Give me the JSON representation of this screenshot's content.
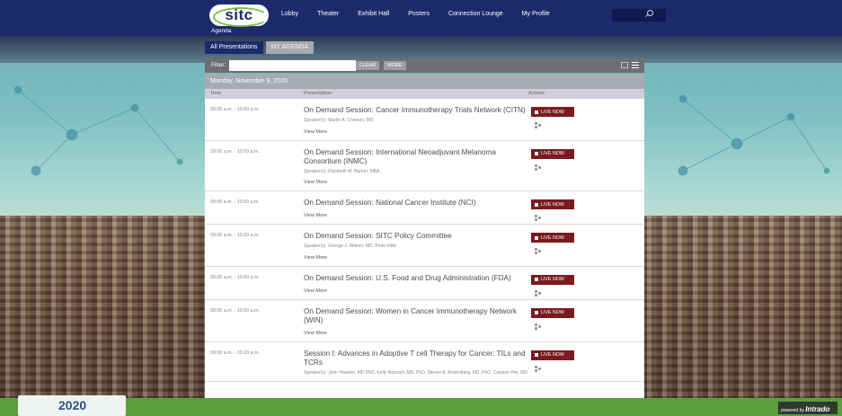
{
  "brand": {
    "logo_text": "sitc",
    "footer_logo_text": "2020",
    "powered_prefix": "powered by",
    "powered_brand": "Intrado"
  },
  "nav": {
    "items": [
      "Lobby",
      "Theater",
      "Exhibit Hall",
      "Posters",
      "Connection Lounge",
      "My Profile"
    ],
    "sub_item": "Agenda"
  },
  "search": {
    "placeholder": ""
  },
  "tabs": [
    "All Presentations",
    "MY AGENDA"
  ],
  "filter": {
    "label": "Filter:",
    "value": "",
    "clear_label": "CLEAR",
    "more_label": "MORE"
  },
  "date_header": "Monday, November 9, 2020",
  "columns": {
    "time": "Time",
    "presentation": "Presentation",
    "actions": "Actions"
  },
  "live_label": "LIVE NOW",
  "view_more_label": "View More",
  "sessions": [
    {
      "time": "09:00 a.m. - 10:00 a.m.",
      "title": "On Demand Session: Cancer Immunotherapy Trials Network (CITN)",
      "speakers": "Speaker(s): Martin A. Cheever, MD",
      "show_more": true
    },
    {
      "time": "09:00 a.m. - 10:00 a.m.",
      "title": "On Demand Session: International Neoadjuvant Melanoma Consortium (INMC)",
      "speakers": "Speaker(s): Elizabeth M. Burton, MBA",
      "show_more": true
    },
    {
      "time": "09:00 a.m. - 10:00 a.m.",
      "title": "On Demand Session: National Cancer Institute (NCI)",
      "speakers": "",
      "show_more": true
    },
    {
      "time": "09:00 a.m. - 10:00 a.m.",
      "title": "On Demand Session: SITC Policy Committee",
      "speakers": "Speaker(s): George J. Weiner, MD, Peter Intile",
      "show_more": true
    },
    {
      "time": "09:00 a.m. - 10:00 a.m.",
      "title": "On Demand Session: U.S. Food and Drug Administration (FDA)",
      "speakers": "",
      "show_more": true
    },
    {
      "time": "09:00 a.m. - 10:00 a.m.",
      "title": "On Demand Session: Women in Cancer Immunotherapy Network (WIN)",
      "speakers": "",
      "show_more": true
    },
    {
      "time": "09:00 a.m. - 10:20 a.m.",
      "title": "Session I: Advances in Adoptive T cell Therapy for Cancer: TILs and TCRs",
      "speakers": "Speaker(s): John Haanen, MD PhD, Kelly Razvani, MD, PhD, Steven A. Rosenberg, MD, PhD, Cassian Yee, MD",
      "show_more": false
    }
  ],
  "colors": {
    "nav_bg": "#1c2a6b",
    "live_btn": "#7a1a1f",
    "footer": "#5c9e3c",
    "accent_green": "#7cc142"
  }
}
